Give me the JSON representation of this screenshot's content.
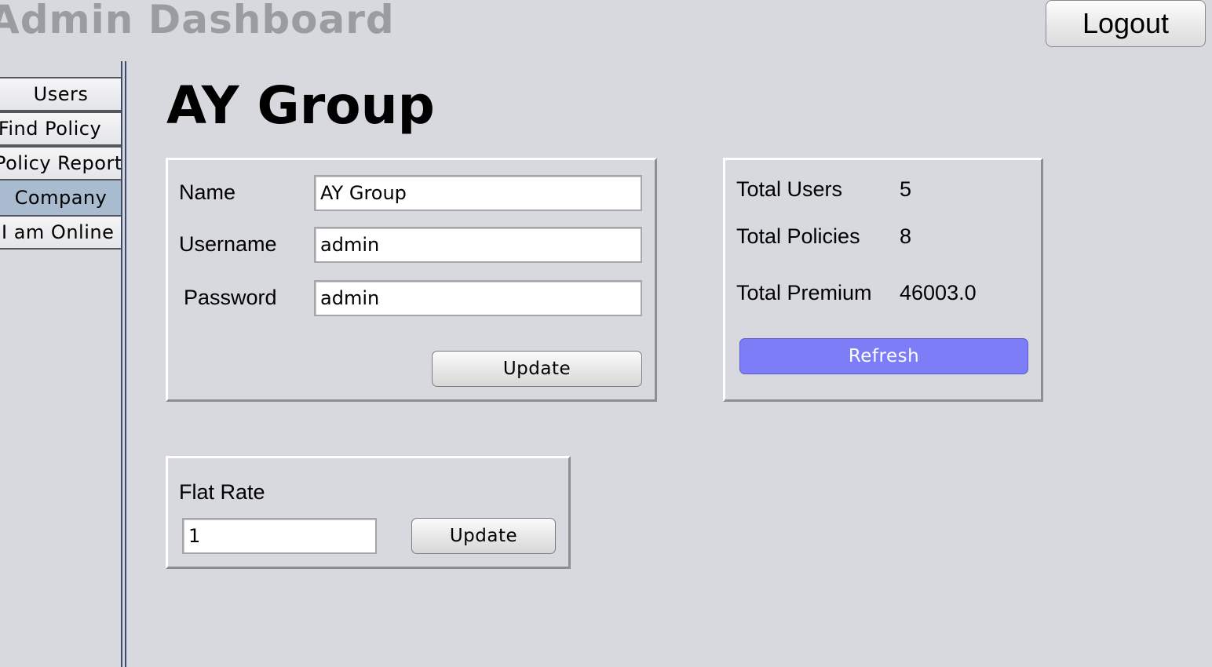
{
  "app": {
    "title": "Admin Dashboard",
    "logout_label": "Logout"
  },
  "sidebar": {
    "items": [
      {
        "label": "Users",
        "selected": false
      },
      {
        "label": "Find Policy",
        "selected": false
      },
      {
        "label": "Policy Report",
        "selected": false
      },
      {
        "label": "Company",
        "selected": true
      },
      {
        "label": "I am Online",
        "selected": false
      }
    ]
  },
  "main": {
    "company_title": "AY Group",
    "info_form": {
      "name_label": "Name",
      "name_value": "AY Group",
      "username_label": "Username",
      "username_value": "admin",
      "password_label": "Password",
      "password_value": "admin",
      "update_label": "Update"
    },
    "stats": {
      "total_users_label": "Total Users",
      "total_users_value": "5",
      "total_policies_label": "Total Policies",
      "total_policies_value": "8",
      "total_premium_label": "Total Premium",
      "total_premium_value": "46003.0",
      "refresh_label": "Refresh"
    },
    "flat_rate": {
      "label": "Flat Rate",
      "value": "1",
      "update_label": "Update"
    }
  },
  "colors": {
    "background": "#d7d9de",
    "selected_nav": "#a9bccf",
    "refresh_button": "#7d7df8",
    "title_gray": "#9b9c9f"
  }
}
